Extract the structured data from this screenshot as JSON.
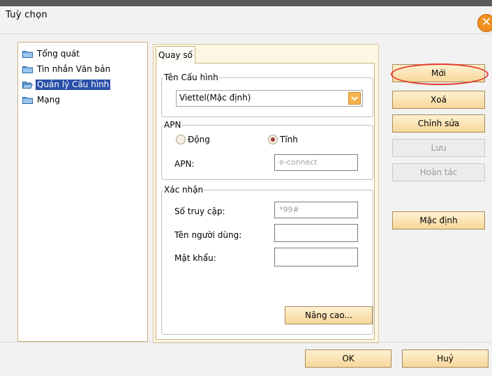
{
  "window": {
    "title": "Tuỳ chọn",
    "close_icon": "close-icon"
  },
  "tree": {
    "items": [
      {
        "label": "Tổng quát",
        "icon": "folder-icon",
        "selected": false
      },
      {
        "label": "Tin nhắn Văn bản",
        "icon": "folder-icon",
        "selected": false
      },
      {
        "label": "Quản lý Cấu hình",
        "icon": "folder-open-icon",
        "selected": true
      },
      {
        "label": "Mạng",
        "icon": "folder-icon",
        "selected": false
      }
    ]
  },
  "tab": {
    "label": "Quay số"
  },
  "profile_group": {
    "legend": "Tên Cấu hình",
    "selected_value": "Viettel(Mặc định)"
  },
  "apn_group": {
    "legend": "APN",
    "radio_dynamic": "Động",
    "radio_static": "Tĩnh",
    "selected": "Tĩnh",
    "apn_label": "APN:",
    "apn_value": "e-connect"
  },
  "auth_group": {
    "legend": "Xác nhận",
    "access_label": "Số truy cập:",
    "access_value": "*99#",
    "username_label": "Tên người dùng:",
    "username_value": "",
    "password_label": "Mật khẩu:",
    "password_value": ""
  },
  "advanced_button": "Nâng cao...",
  "side_buttons": {
    "new": "Mới",
    "delete": "Xoá",
    "edit": "Chỉnh sửa",
    "save": "Lưu",
    "undo": "Hoàn tác",
    "default": "Mặc định"
  },
  "footer": {
    "ok": "OK",
    "cancel": "Huỷ"
  },
  "colors": {
    "accent_orange": "#f0901e",
    "highlight_ring": "#e53a2a",
    "selection": "#2a4fa8"
  }
}
